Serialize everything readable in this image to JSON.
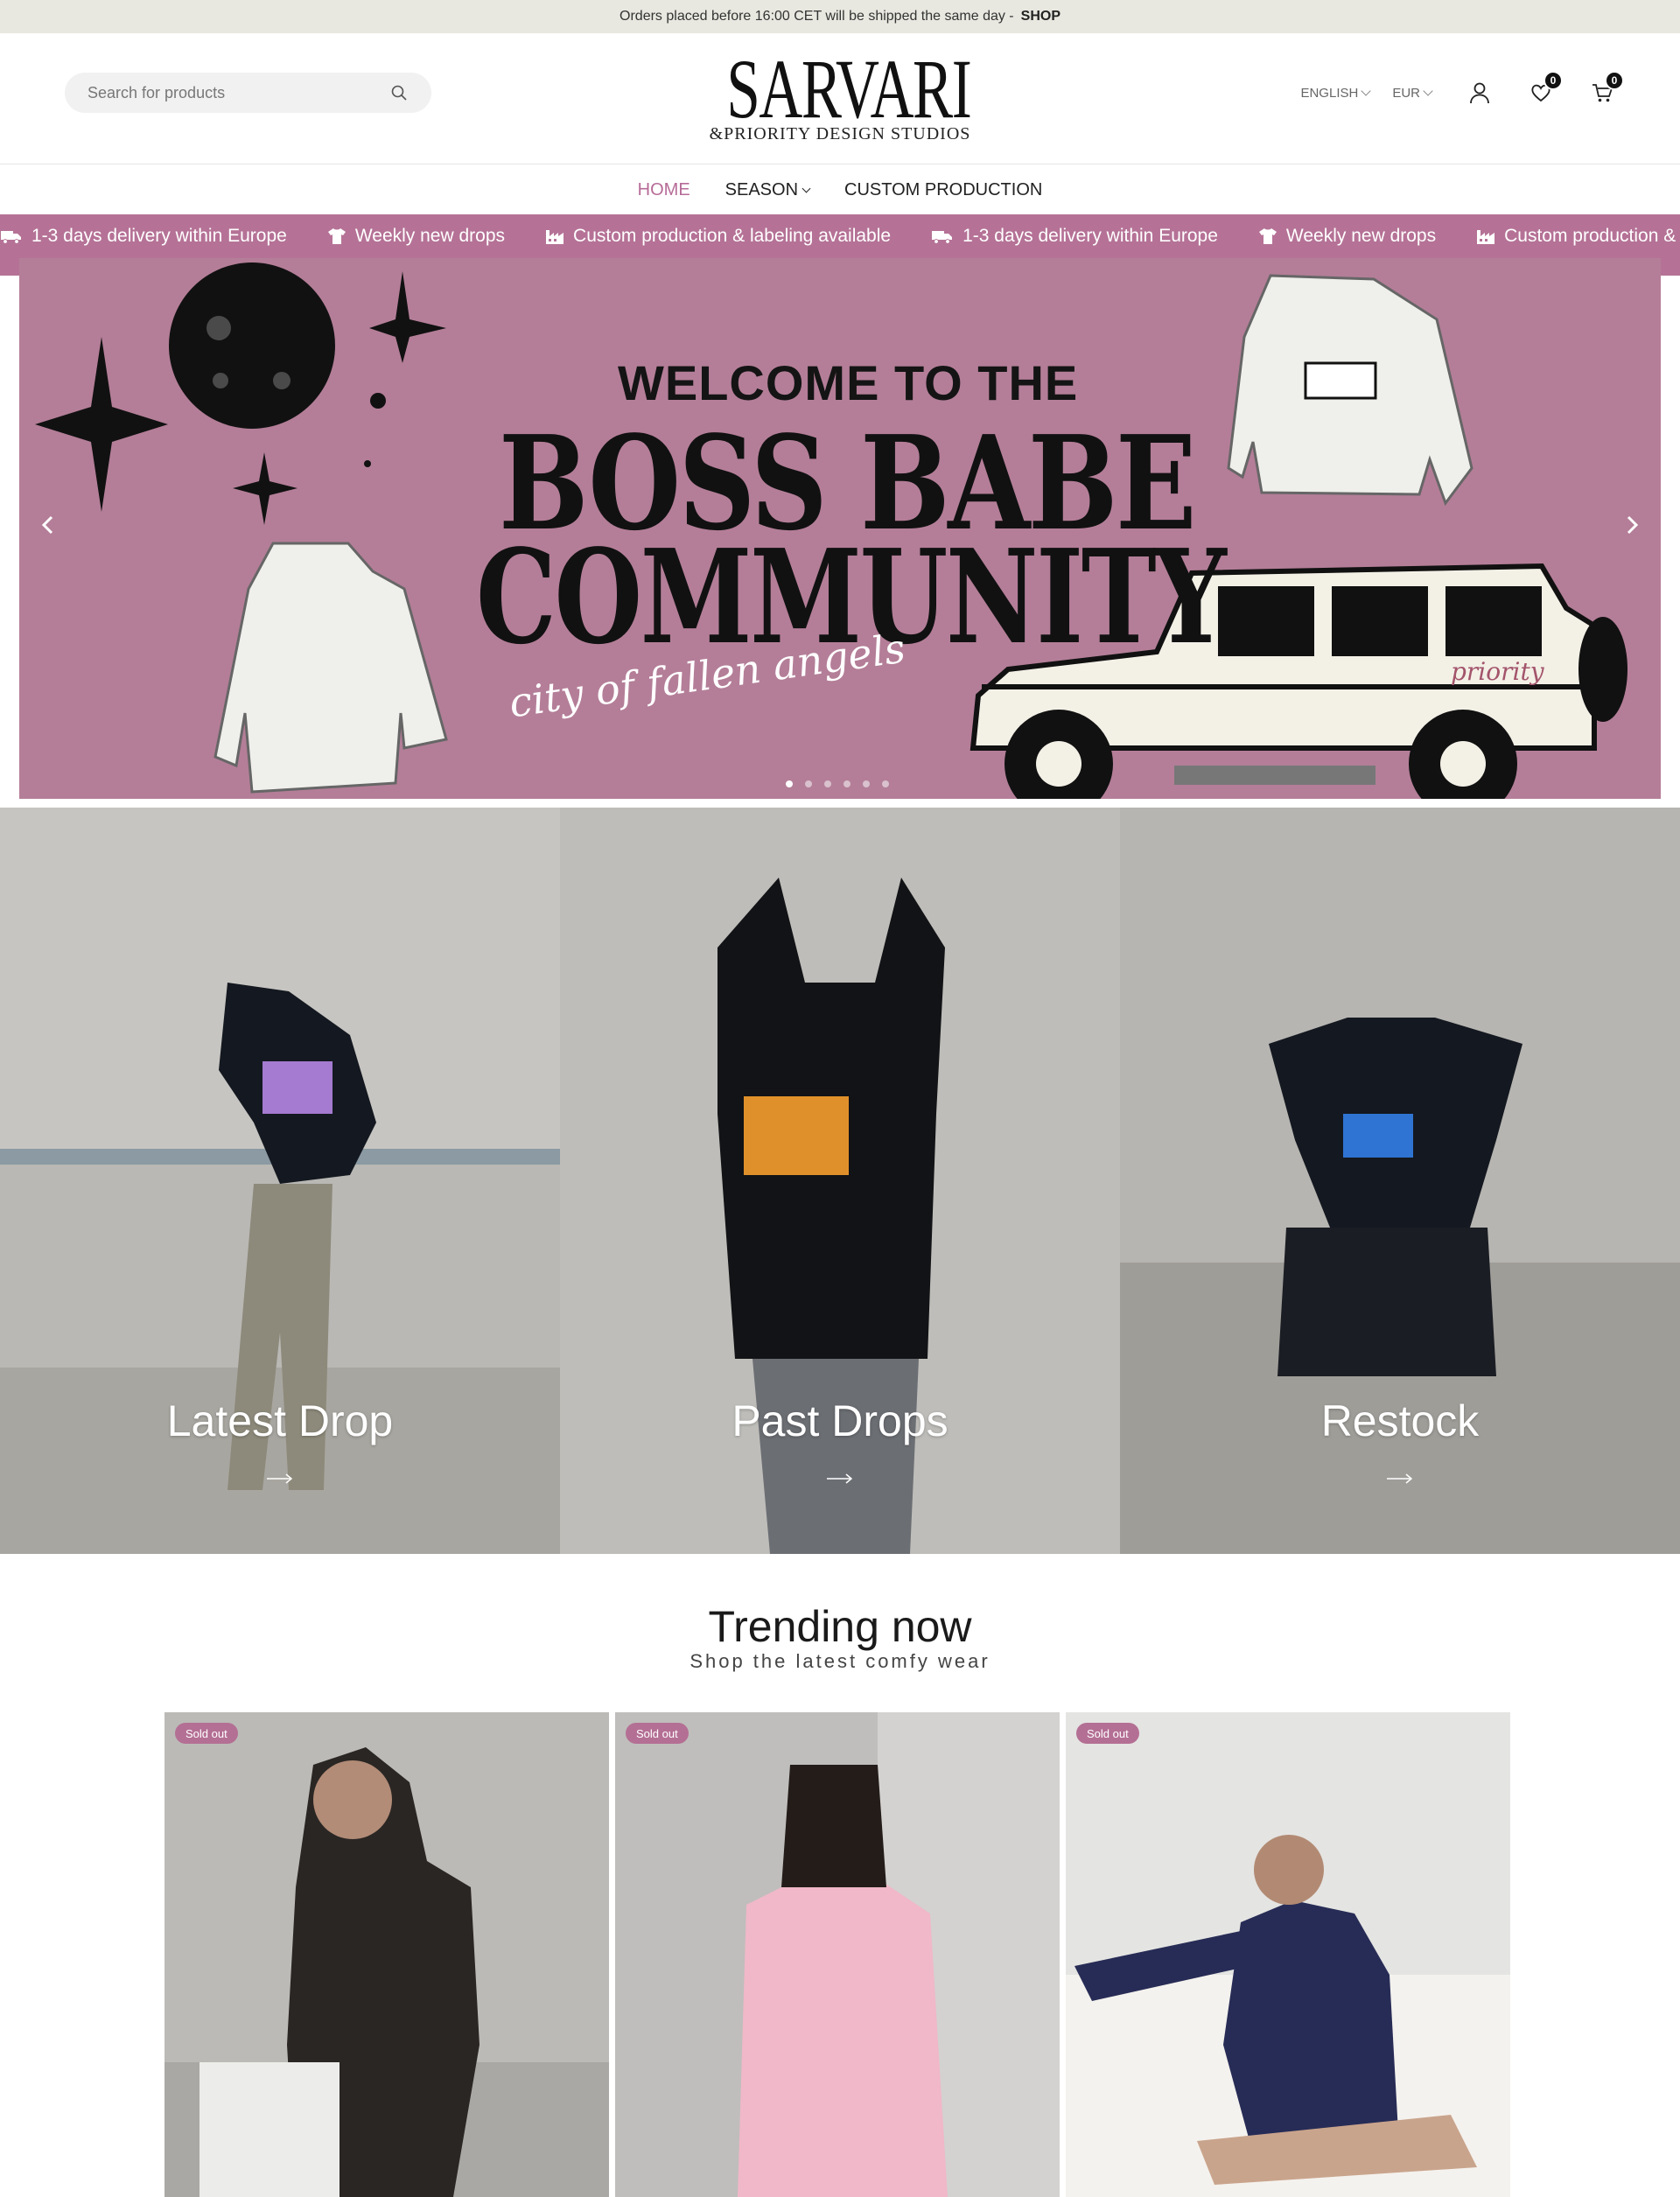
{
  "announcement": {
    "text": "Orders placed before 16:00 CET will be shipped the same day -",
    "link": "SHOP"
  },
  "header": {
    "search_placeholder": "Search for products",
    "logo_main": "SARVARI",
    "logo_sub": "&PRIORITY DESIGN STUDIOS",
    "language": "ENGLISH",
    "currency": "EUR",
    "wishlist_count": "0",
    "cart_count": "0"
  },
  "nav": {
    "items": [
      {
        "label": "HOME",
        "active": true
      },
      {
        "label": "SEASON",
        "dropdown": true
      },
      {
        "label": "CUSTOM PRODUCTION"
      }
    ]
  },
  "ticker": {
    "items": [
      {
        "icon": "truck-icon",
        "label": "1-3 days delivery within Europe"
      },
      {
        "icon": "tshirt-icon",
        "label": "Weekly new drops"
      },
      {
        "icon": "factory-icon",
        "label": "Custom production & labeling available"
      },
      {
        "icon": "truck-icon",
        "label": "1-3 days delivery within Europe"
      },
      {
        "icon": "tshirt-icon",
        "label": "Weekly new drops"
      },
      {
        "icon": "factory-icon",
        "label": "Custom production & labeling available"
      }
    ]
  },
  "hero": {
    "line1": "WELCOME TO THE",
    "line2": "BOSS BABE",
    "line3": "COMMUNITY",
    "script": "city of fallen angels",
    "car_label": "priority",
    "slide_count": 6,
    "active_slide": 1,
    "background": "#b47e98"
  },
  "collections": [
    {
      "title": "Latest Drop"
    },
    {
      "title": "Past Drops"
    },
    {
      "title": "Restock"
    }
  ],
  "trending": {
    "title": "Trending now",
    "subtitle": "Shop the latest comfy wear",
    "products": [
      {
        "badge": "Sold out"
      },
      {
        "badge": "Sold out"
      },
      {
        "badge": "Sold out"
      }
    ]
  },
  "colors": {
    "accent": "#b66b97",
    "ticker": "#b57296",
    "announcement": "#e8e8e0"
  }
}
